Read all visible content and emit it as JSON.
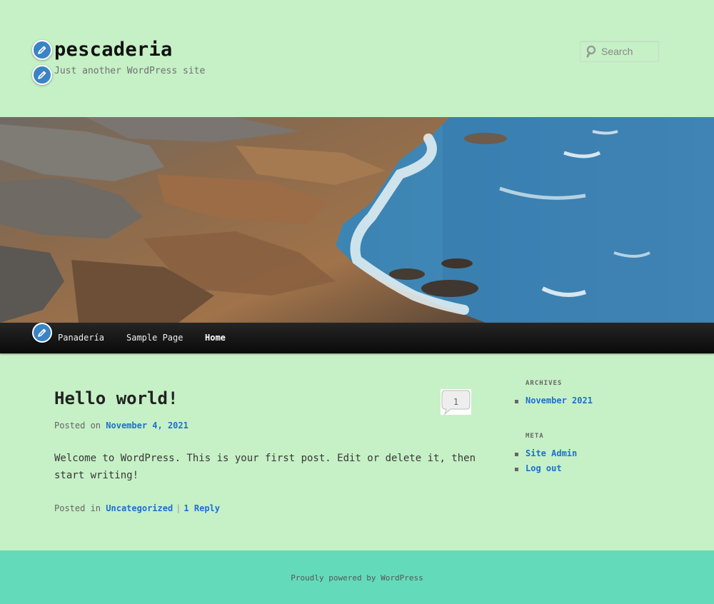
{
  "site": {
    "title": "pescaderia",
    "description": "Just another WordPress site"
  },
  "search": {
    "placeholder": "Search"
  },
  "nav": {
    "items": [
      {
        "label": "Panadería"
      },
      {
        "label": "Sample Page"
      },
      {
        "label": "Home"
      }
    ]
  },
  "post": {
    "title": "Hello world!",
    "comment_count": "1",
    "posted_on_prefix": "Posted on",
    "date": "November 4, 2021",
    "content": "Welcome to WordPress. This is your first post. Edit or delete it, then start writing!",
    "posted_in_prefix": "Posted in",
    "category": "Uncategorized",
    "separator": "|",
    "reply_link": "1 Reply"
  },
  "sidebar": {
    "archives_title": "Archives",
    "archives": [
      "November 2021"
    ],
    "meta_title": "Meta",
    "meta_links": [
      "Site Admin",
      "Log out"
    ]
  },
  "footer": {
    "text": "Proudly powered by WordPress"
  },
  "colors": {
    "background": "#c6f0c6",
    "footer_bg": "#63dbbb",
    "link": "#1b6fd3",
    "nav_bg": "#111111",
    "edit_shortcut": "#3a84c5"
  }
}
